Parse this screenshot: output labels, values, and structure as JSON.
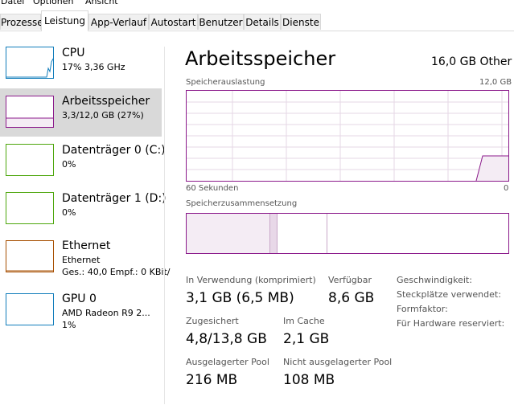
{
  "menu": {
    "items": [
      "Datei",
      "Optionen",
      "Ansicht"
    ]
  },
  "tabs": [
    {
      "label": "Prozesse",
      "active": false
    },
    {
      "label": "Leistung",
      "active": true
    },
    {
      "label": "App-Verlauf",
      "active": false
    },
    {
      "label": "Autostart",
      "active": false
    },
    {
      "label": "Benutzer",
      "active": false
    },
    {
      "label": "Details",
      "active": false
    },
    {
      "label": "Dienste",
      "active": false
    }
  ],
  "sidebar": {
    "items": [
      {
        "title": "CPU",
        "subtitle": "17%  3,36 GHz",
        "color": "#117dbb",
        "selected": false
      },
      {
        "title": "Arbeitsspeicher",
        "subtitle": "3,3/12,0 GB (27%)",
        "color": "#8b1a8b",
        "selected": true
      },
      {
        "title": "Datenträger 0 (C:)",
        "subtitle": "0%",
        "color": "#4da60c",
        "selected": false
      },
      {
        "title": "Datenträger 1 (D:)",
        "subtitle": "0%",
        "color": "#4da60c",
        "selected": false
      },
      {
        "title": "Ethernet",
        "subtitle": "Ethernet",
        "subtitle2": "Ges.: 40,0  Empf.: 0 KBit/",
        "color": "#a74f01",
        "selected": false
      },
      {
        "title": "GPU 0",
        "subtitle": "AMD Radeon R9 2...",
        "subtitle2": "1%",
        "color": "#117dbb",
        "selected": false
      }
    ]
  },
  "main": {
    "title": "Arbeitsspeicher",
    "total": "16,0 GB Other",
    "usage_label": "Speicherauslastung",
    "usage_max": "12,0 GB",
    "time_label": "60 Sekunden",
    "time_min": "0",
    "composition_label": "Speicherzusammensetzung",
    "stats": {
      "in_use_label": "In Verwendung (komprimiert)",
      "in_use_value": "3,1 GB (6,5 MB)",
      "available_label": "Verfügbar",
      "available_value": "8,6 GB",
      "committed_label": "Zugesichert",
      "committed_value": "4,8/13,8 GB",
      "cached_label": "Im Cache",
      "cached_value": "2,1 GB",
      "paged_label": "Ausgelagerter Pool",
      "paged_value": "216 MB",
      "nonpaged_label": "Nicht ausgelagerter Pool",
      "nonpaged_value": "108 MB"
    },
    "details": {
      "speed_label": "Geschwindigkeit:",
      "slots_label": "Steckplätze verwendet:",
      "form_label": "Formfaktor:",
      "reserved_label": "Für Hardware reserviert:"
    }
  },
  "colors": {
    "memory": "#8b1a8b",
    "grid": "#e6d7e6",
    "selected_bg": "#d9d9d9"
  }
}
